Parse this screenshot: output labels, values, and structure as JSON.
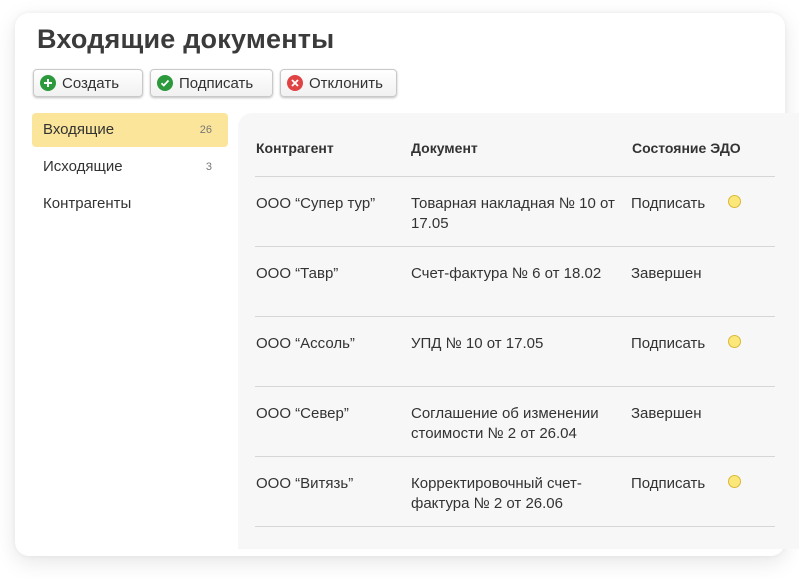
{
  "page": {
    "title": "Входящие документы"
  },
  "toolbar": {
    "create_label": "Создать",
    "sign_label": "Подписать",
    "reject_label": "Отклонить",
    "create_icon": "plus-circle-icon",
    "sign_icon": "check-circle-icon",
    "reject_icon": "x-circle-icon",
    "create_color": "#2c9a3c",
    "sign_color": "#2c9a3c",
    "reject_color": "#e04343"
  },
  "sidebar": {
    "items": [
      {
        "label": "Входящие",
        "count": "26",
        "active": true
      },
      {
        "label": "Исходящие",
        "count": "3",
        "active": false
      },
      {
        "label": "Контрагенты",
        "count": "",
        "active": false
      }
    ],
    "active_color": "#fbe59a"
  },
  "table": {
    "columns": [
      "Контрагент",
      "Документ",
      "Состояние ЭДО"
    ],
    "rows": [
      {
        "counterparty": "ООО “Супер тур”",
        "document": "Товарная накладная  № 10 от 17.05",
        "status": "Подписать",
        "pending": true
      },
      {
        "counterparty": "ООО “Тавр”",
        "document": "Счет-фактура № 6 от 18.02",
        "status": "Завершен",
        "pending": false
      },
      {
        "counterparty": "ООО “Ассоль”",
        "document": "УПД № 10 от 17.05",
        "status": "Подписать",
        "pending": true
      },
      {
        "counterparty": "ООО “Север”",
        "document": "Соглашение об изменении стоимости № 2 от 26.04",
        "status": "Завершен",
        "pending": false
      },
      {
        "counterparty": "ООО “Витязь”",
        "document": "Корректировочный счет-фактура № 2 от 26.06",
        "status": "Подписать",
        "pending": true
      }
    ],
    "pending_dot_color": "#fce77a"
  }
}
